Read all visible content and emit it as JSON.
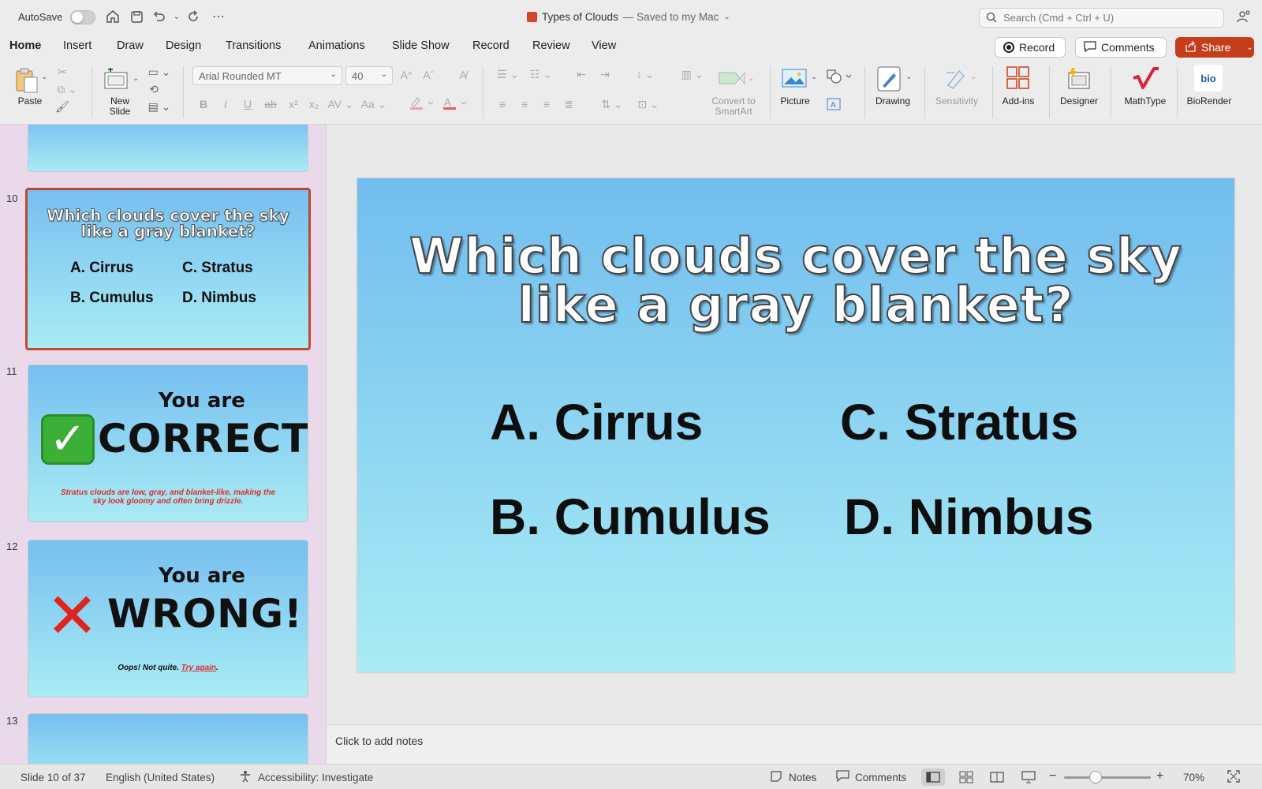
{
  "titlebar": {
    "autosave_label": "AutoSave",
    "doc_name": "Types of Clouds",
    "saved_status": "— Saved to my Mac",
    "search_placeholder": "Search (Cmd + Ctrl + U)"
  },
  "tabs": [
    "Home",
    "Insert",
    "Draw",
    "Design",
    "Transitions",
    "Animations",
    "Slide Show",
    "Record",
    "Review",
    "View"
  ],
  "active_tab": "Home",
  "header_buttons": {
    "record": "Record",
    "comments": "Comments",
    "share": "Share"
  },
  "ribbon": {
    "paste": "Paste",
    "new_slide_1": "New",
    "new_slide_2": "Slide",
    "font_name": "Arial Rounded MT",
    "font_size": "40",
    "convert_smartart_1": "Convert to",
    "convert_smartart_2": "SmartArt",
    "picture": "Picture",
    "drawing": "Drawing",
    "sensitivity": "Sensitivity",
    "addins": "Add-ins",
    "designer": "Designer",
    "mathtype": "MathType",
    "biorender": "BioRender",
    "biorender_logo": "bio"
  },
  "thumbnails": {
    "slide10": {
      "num": "10",
      "title_1": "Which clouds cover the sky",
      "title_2": "like a gray blanket?",
      "opt_a": "A. Cirrus",
      "opt_b": "B. Cumulus",
      "opt_c": "C. Stratus",
      "opt_d": "D. Nimbus"
    },
    "slide11": {
      "num": "11",
      "line1": "You are",
      "line2": "CORRECT!",
      "note_1": "Stratus clouds are low, gray, and blanket-like, making the",
      "note_2": "sky look gloomy and often bring drizzle."
    },
    "slide12": {
      "num": "12",
      "line1": "You are",
      "line2": "WRONG!",
      "note_a": "Oops! Not quite. ",
      "note_link": "Try again",
      "note_end": "."
    },
    "slide13": {
      "num": "13"
    }
  },
  "slide": {
    "title_1": "Which clouds cover the sky",
    "title_2": "like a gray blanket?",
    "opt_a": "A. Cirrus",
    "opt_b": "B. Cumulus",
    "opt_c": "C. Stratus",
    "opt_d": "D. Nimbus"
  },
  "notes_placeholder": "Click to add notes",
  "status": {
    "slide_count": "Slide 10 of 37",
    "language": "English (United States)",
    "accessibility": "Accessibility: Investigate",
    "notes": "Notes",
    "comments": "Comments",
    "zoom": "70%"
  },
  "colors": {
    "accent": "#c43e1c",
    "slide_top": "#72bdef",
    "slide_bottom": "#a9ecf4"
  }
}
